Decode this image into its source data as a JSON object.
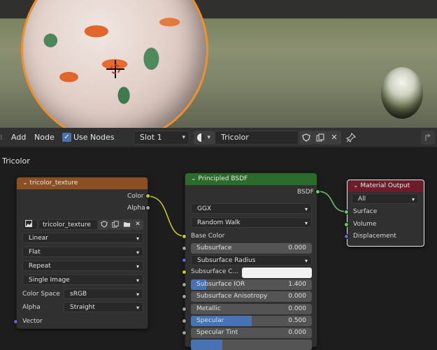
{
  "toolbar": {
    "add_label": "Add",
    "node_label": "Node",
    "use_nodes_label": "Use Nodes",
    "slot_label": "Slot 1",
    "material_name": "Tricolor"
  },
  "editor": {
    "title": "Tricolor"
  },
  "image_node": {
    "title": "tricolor_texture",
    "out_color": "Color",
    "out_alpha": "Alpha",
    "image_name": "tricolor_texture",
    "interpolation": "Linear",
    "projection": "Flat",
    "extension": "Repeat",
    "source": "Single Image",
    "color_space_label": "Color Space",
    "color_space": "sRGB",
    "alpha_label": "Alpha",
    "alpha_mode": "Straight",
    "in_vector": "Vector"
  },
  "bsdf_node": {
    "title": "Principled BSDF",
    "out_bsdf": "BSDF",
    "distribution": "GGX",
    "subsurface_method": "Random Walk",
    "base_color": "Base Color",
    "subsurface_label": "Subsurface",
    "subsurface_value": "0.000",
    "subsurface_radius": "Subsurface Radius",
    "subsurface_color": "Subsurface C...",
    "subsurface_ior_label": "Subsurface IOR",
    "subsurface_ior_value": "1.400",
    "subsurface_anisotropy_label": "Subsurface Anisotropy",
    "subsurface_anisotropy_value": "0.000",
    "metallic_label": "Metallic",
    "metallic_value": "0.000",
    "specular_label": "Specular",
    "specular_value": "0.500",
    "specular_fill": 0.5,
    "specular_tint_label": "Specular Tint",
    "specular_tint_value": "0.000"
  },
  "output_node": {
    "title": "Material Output",
    "target": "All",
    "in_surface": "Surface",
    "in_volume": "Volume",
    "in_displacement": "Displacement"
  },
  "colors": {
    "texture_header": "#8a4f23",
    "shader_header": "#2b6b2b",
    "output_header": "#6b1e2a",
    "accent": "#4772b3"
  }
}
